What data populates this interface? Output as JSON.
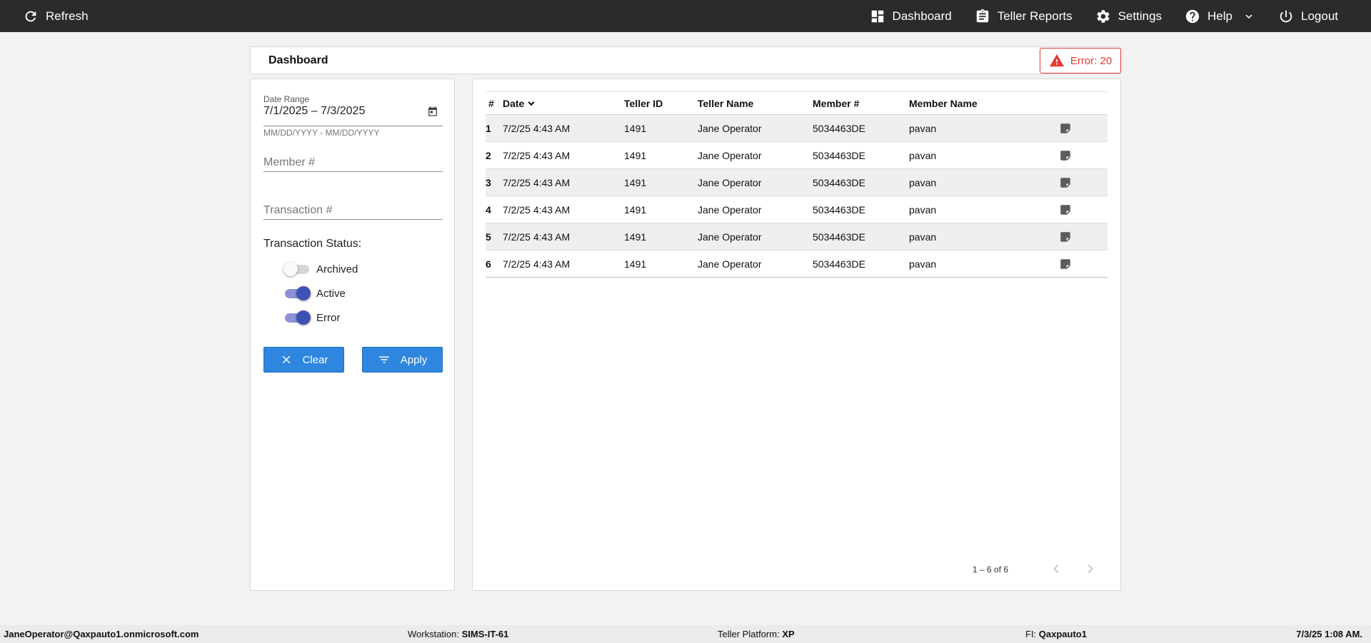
{
  "topbar": {
    "refresh_label": "Refresh",
    "nav": [
      {
        "label": "Dashboard",
        "icon": "dashboard-icon"
      },
      {
        "label": "Teller Reports",
        "icon": "clipboard-icon"
      },
      {
        "label": "Settings",
        "icon": "gear-icon"
      },
      {
        "label": "Help",
        "icon": "help-icon"
      },
      {
        "label": "Logout",
        "icon": "power-icon"
      }
    ]
  },
  "header": {
    "title": "Dashboard",
    "error_chip": "Error: 20"
  },
  "filters": {
    "date_range_label": "Date Range",
    "date_range_value": "7/1/2025 – 7/3/2025",
    "date_hint": "MM/DD/YYYY - MM/DD/YYYY",
    "member_placeholder": "Member #",
    "member_value": "",
    "transaction_placeholder": "Transaction #",
    "transaction_value": "",
    "status_label": "Transaction Status:",
    "toggles": [
      {
        "label": "Archived",
        "on": false
      },
      {
        "label": "Active",
        "on": true
      },
      {
        "label": "Error",
        "on": true
      }
    ],
    "clear_label": "Clear",
    "apply_label": "Apply"
  },
  "table": {
    "columns": [
      "#",
      "Date",
      "Teller ID",
      "Teller Name",
      "Member #",
      "Member Name"
    ],
    "rows": [
      {
        "num": "1",
        "date": "7/2/25 4:43 AM",
        "teller_id": "1491",
        "teller_name": "Jane Operator",
        "member": "5034463DE",
        "member_name": "pavan"
      },
      {
        "num": "2",
        "date": "7/2/25 4:43 AM",
        "teller_id": "1491",
        "teller_name": "Jane Operator",
        "member": "5034463DE",
        "member_name": "pavan"
      },
      {
        "num": "3",
        "date": "7/2/25 4:43 AM",
        "teller_id": "1491",
        "teller_name": "Jane Operator",
        "member": "5034463DE",
        "member_name": "pavan"
      },
      {
        "num": "4",
        "date": "7/2/25 4:43 AM",
        "teller_id": "1491",
        "teller_name": "Jane Operator",
        "member": "5034463DE",
        "member_name": "pavan"
      },
      {
        "num": "5",
        "date": "7/2/25 4:43 AM",
        "teller_id": "1491",
        "teller_name": "Jane Operator",
        "member": "5034463DE",
        "member_name": "pavan"
      },
      {
        "num": "6",
        "date": "7/2/25 4:43 AM",
        "teller_id": "1491",
        "teller_name": "Jane Operator",
        "member": "5034463DE",
        "member_name": "pavan"
      }
    ],
    "paginator": "1 – 6 of 6"
  },
  "footer": {
    "user": "JaneOperator@Qaxpauto1.onmicrosoft.com",
    "workstation_label": "Workstation:",
    "workstation_value": "SIMS-IT-61",
    "platform_label": "Teller Platform:",
    "platform_value": "XP",
    "fi_label": "FI:",
    "fi_value": "Qaxpauto1",
    "time": "7/3/25 1:08 AM."
  },
  "colors": {
    "topbar": "#2b2b2b",
    "error": "#e53935",
    "button": "#2e86de",
    "toggle_on": "#3f51b5"
  }
}
